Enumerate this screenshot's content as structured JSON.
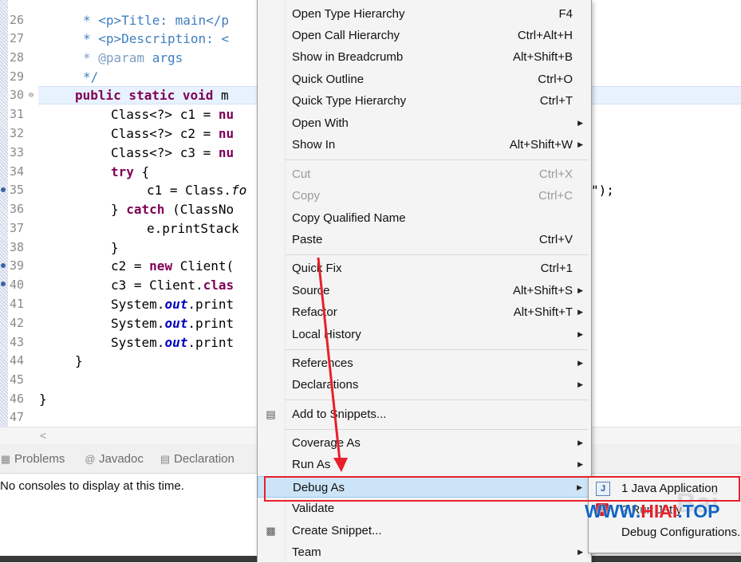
{
  "editor": {
    "line_numbers": [
      "26",
      "27",
      "28",
      "29",
      "30",
      "31",
      "32",
      "33",
      "34",
      "35",
      "36",
      "37",
      "38",
      "39",
      "40",
      "41",
      "42",
      "43",
      "44",
      "45",
      "46",
      "47"
    ],
    "lines": {
      "l26": "* <p>Title: main</p",
      "l27": "* <p>Description: <",
      "l28_tag": "* @param",
      "l28_rest": " args",
      "l29": "*/",
      "l30_kw": "public static void",
      "l30_rest": " m",
      "l31_a": "Class<?> c1 = ",
      "l31_kw": "nu",
      "l32_a": "Class<?> c2 = ",
      "l32_kw": "nu",
      "l33_a": "Class<?> c3 = ",
      "l33_kw": "nu",
      "l34_kw": "try",
      "l34_rest": " {",
      "l35_a": "c1 = Class.",
      "l35_it": "fo",
      "l35_tail": "\");",
      "l36_a": "} ",
      "l36_kw": "catch",
      "l36_rest": " (ClassNo",
      "l37": "e.printStack",
      "l38": "}",
      "l39_a": "c2 = ",
      "l39_kw": "new",
      "l39_rest": " Client(",
      "l40_a": "c3 = Client.",
      "l40_kw": "clas",
      "l41_a": "System.",
      "l41_f": "out",
      "l41_rest": ".print",
      "l42_a": "System.",
      "l42_f": "out",
      "l42_rest": ".print",
      "l43_a": "System.",
      "l43_f": "out",
      "l43_rest": ".print",
      "l44": "}",
      "l46": "}"
    }
  },
  "hscroll": {
    "left_arrow": "<"
  },
  "panel": {
    "tabs": [
      {
        "label": "Problems",
        "icon": "problems-icon"
      },
      {
        "label": "Javadoc",
        "icon": "at-icon"
      },
      {
        "label": "Declaration",
        "icon": "declaration-icon"
      }
    ],
    "console_message": "No consoles to display at this time."
  },
  "context_menu": {
    "items": [
      {
        "label": "Open Type Hierarchy",
        "shortcut": "F4"
      },
      {
        "label": "Open Call Hierarchy",
        "shortcut": "Ctrl+Alt+H"
      },
      {
        "label": "Show in Breadcrumb",
        "shortcut": "Alt+Shift+B"
      },
      {
        "label": "Quick Outline",
        "shortcut": "Ctrl+O"
      },
      {
        "label": "Quick Type Hierarchy",
        "shortcut": "Ctrl+T"
      },
      {
        "label": "Open With",
        "shortcut": ""
      },
      {
        "label": "Show In",
        "shortcut": "Alt+Shift+W"
      },
      {
        "label": "Cut",
        "shortcut": "Ctrl+X"
      },
      {
        "label": "Copy",
        "shortcut": "Ctrl+C"
      },
      {
        "label": "Copy Qualified Name",
        "shortcut": ""
      },
      {
        "label": "Paste",
        "shortcut": "Ctrl+V"
      },
      {
        "label": "Quick Fix",
        "shortcut": "Ctrl+1"
      },
      {
        "label": "Source",
        "shortcut": "Alt+Shift+S"
      },
      {
        "label": "Refactor",
        "shortcut": "Alt+Shift+T"
      },
      {
        "label": "Local History",
        "shortcut": ""
      },
      {
        "label": "References",
        "shortcut": ""
      },
      {
        "label": "Declarations",
        "shortcut": ""
      },
      {
        "label": "Add to Snippets...",
        "shortcut": ""
      },
      {
        "label": "Coverage As",
        "shortcut": ""
      },
      {
        "label": "Run As",
        "shortcut": ""
      },
      {
        "label": "Debug As",
        "shortcut": ""
      },
      {
        "label": "Validate",
        "shortcut": ""
      },
      {
        "label": "Create Snippet...",
        "shortcut": ""
      },
      {
        "label": "Team",
        "shortcut": ""
      }
    ],
    "highlighted": "Debug As"
  },
  "submenu": {
    "items": [
      {
        "label": "1 Java Application",
        "icon": "java-app-icon"
      },
      {
        "label": "2 Run Jetty",
        "icon": "jetty-icon"
      },
      {
        "label": "Debug Configurations...",
        "icon": ""
      }
    ]
  },
  "watermark": {
    "text_a": "WWW.",
    "text_b": "HIAI",
    "text_c": ".TOP",
    "baidu": "Bai"
  },
  "colors": {
    "highlight": "#cce4f7",
    "annotation_red": "#e8202a",
    "keyword": "#7f0055",
    "comment": "#3f7fbf"
  }
}
